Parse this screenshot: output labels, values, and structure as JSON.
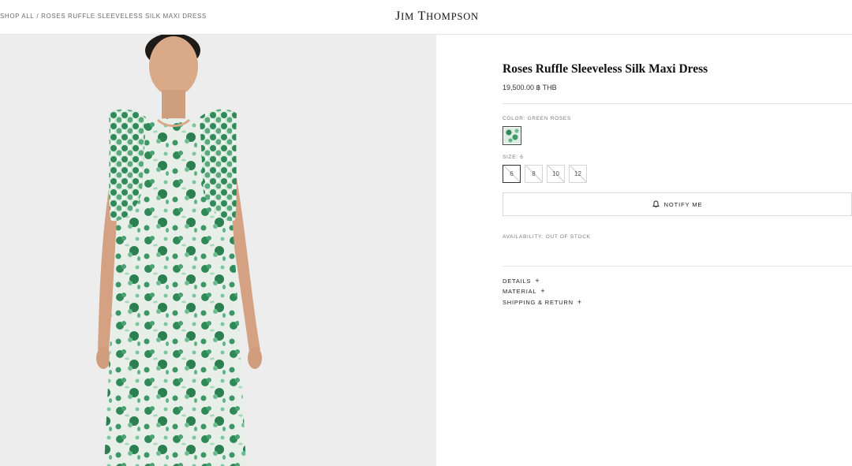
{
  "header": {
    "breadcrumb": {
      "root": "SHOP ALL",
      "separator": "/",
      "current": "ROSES RUFFLE SLEEVELESS SILK MAXI DRESS"
    },
    "logo_first": "J",
    "logo_first_rest": "IM",
    "logo_second": "T",
    "logo_second_rest": "HOMPSON"
  },
  "product": {
    "title": "Roses Ruffle Sleeveless Silk Maxi Dress",
    "price": "19,500.00 ฿ THB",
    "color_label": "COLOR: GREEN ROSES",
    "size_label": "SIZE: 6",
    "sizes": [
      "6",
      "8",
      "10",
      "12"
    ],
    "notify_label": "NOTIFY ME",
    "availability": "AVAILABILITY: OUT OF STOCK",
    "accordions": [
      "DETAILS",
      "MATERIAL",
      "SHIPPING & RETURN"
    ],
    "plus": "+"
  },
  "colors": {
    "gallery_bg": "#ededed",
    "dress_green": "#2f8a58",
    "dress_base": "#e9efe9"
  },
  "icons": {
    "notify": "bell-icon",
    "swatch": "green-roses-swatch"
  }
}
